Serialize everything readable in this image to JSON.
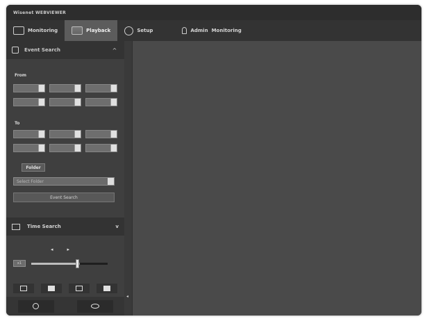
{
  "window": {
    "title": "Wisenet WEBVIEWER"
  },
  "menu": {
    "tabs": [
      {
        "label": "Monitoring",
        "icon": "monitor-icon"
      },
      {
        "label": "Playback",
        "icon": "playback-icon"
      },
      {
        "label": "Setup",
        "icon": "gear-icon"
      }
    ],
    "user_label": "Admin",
    "user_status": "Monitoring"
  },
  "event_search": {
    "title": "Event Search",
    "toggle": "^",
    "from_label": "From",
    "to_label": "To",
    "folder_label": "Folder",
    "folder_value": "Select Folder",
    "search_button": "Event Search"
  },
  "time_search": {
    "title": "Time Search",
    "toggle": "v"
  },
  "playback": {
    "prev_glyph": "◂",
    "next_glyph": "▸",
    "speed_label": "x1",
    "speed_fraction": 0.6
  },
  "colors": {
    "window_bg": "#4b4b4b",
    "titlebar_bg": "#2d2d2d",
    "sidebar_bg": "#3f3f3f",
    "active_tab_bg": "#5c5c5c"
  }
}
